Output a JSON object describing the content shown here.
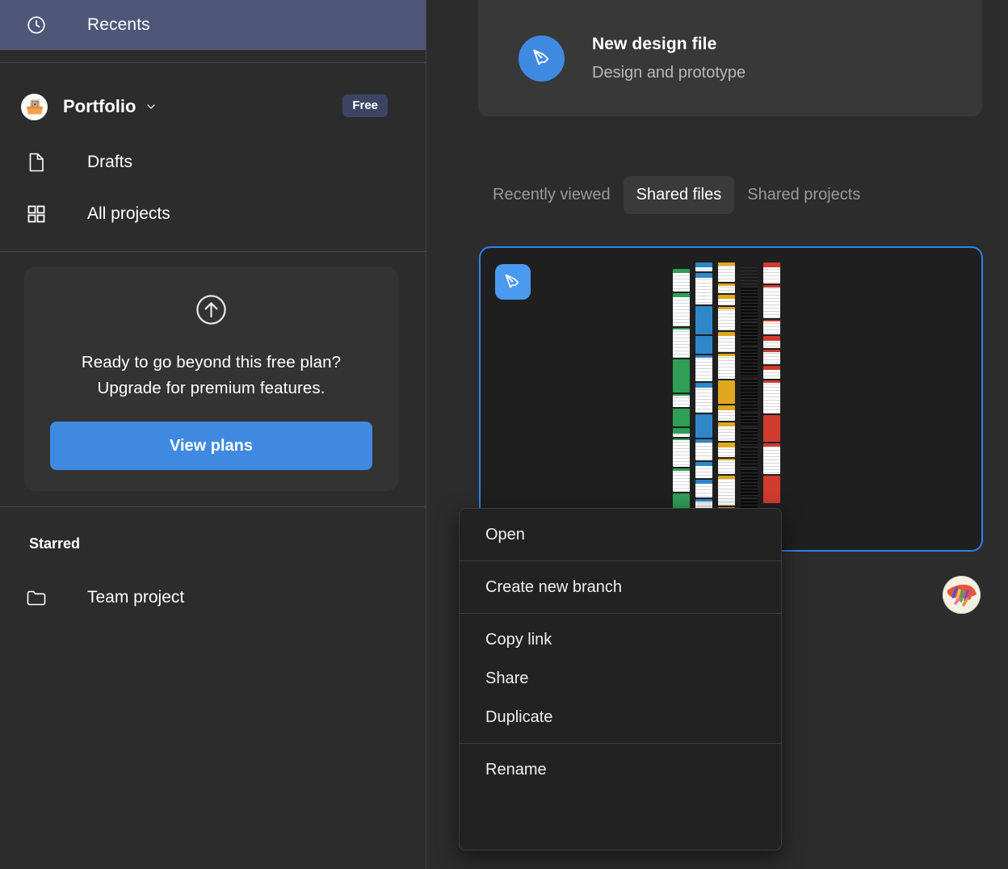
{
  "colors": {
    "sidebar_bg": "#2c2c2c",
    "recents_highlight": "#4e5777",
    "accent_blue": "#3f8ae0",
    "card_border_blue": "#2f80ed",
    "badge_bg": "#3d4463",
    "menu_bg": "#222222",
    "panel_bg": "#383838"
  },
  "sidebar": {
    "recents": {
      "label": "Recents",
      "icon": "clock-icon"
    },
    "portfolio": {
      "label": "Portfolio",
      "icon": "portfolio-avatar",
      "caret": "chevron-down-icon",
      "badge": "Free"
    },
    "nav_items": [
      {
        "label": "Drafts",
        "icon": "file-icon"
      },
      {
        "label": "All projects",
        "icon": "grid-icon"
      }
    ],
    "upgrade": {
      "icon": "arrow-up-circle-icon",
      "line1": "Ready to go beyond this free plan?",
      "line2": "Upgrade for premium features.",
      "button": "View plans"
    },
    "starred": {
      "heading": "Starred",
      "items": [
        {
          "label": "Team project",
          "icon": "folder-icon"
        }
      ]
    }
  },
  "main": {
    "new_file_card": {
      "icon": "pen-tool-icon",
      "title": "New design file",
      "subtitle": "Design and prototype"
    },
    "tabs": [
      {
        "label": "Recently viewed",
        "active": false
      },
      {
        "label": "Shared files",
        "active": true
      },
      {
        "label": "Shared projects",
        "active": false
      }
    ],
    "file_card": {
      "badge_icon": "pen-tool-icon",
      "selected": true,
      "avatar": "collaborator-avatar"
    }
  },
  "context_menu": {
    "groups": [
      {
        "items": [
          {
            "label": "Open"
          }
        ]
      },
      {
        "items": [
          {
            "label": "Create new branch"
          }
        ]
      },
      {
        "items": [
          {
            "label": "Copy link"
          },
          {
            "label": "Share"
          },
          {
            "label": "Duplicate"
          }
        ]
      },
      {
        "items": [
          {
            "label": "Rename"
          }
        ]
      }
    ]
  },
  "thumbnail": {
    "columns": [
      {
        "theme": "green",
        "base": "#ffffff",
        "accent": "#2f9e57"
      },
      {
        "theme": "blue",
        "base": "#ffffff",
        "accent": "#2f86c8"
      },
      {
        "theme": "gold",
        "base": "#ffffff",
        "accent": "#e0a81c"
      },
      {
        "theme": "black",
        "base": "#111111",
        "accent": "#2a2a2a"
      },
      {
        "theme": "red",
        "base": "#ffffff",
        "accent": "#cf3b2f"
      }
    ]
  }
}
